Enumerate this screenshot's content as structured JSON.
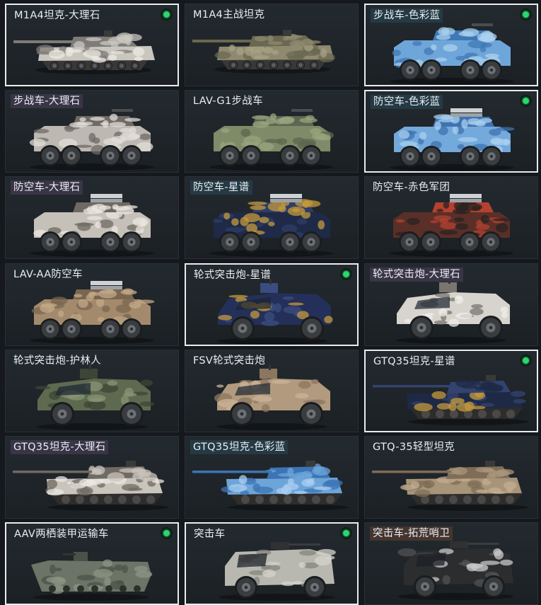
{
  "items": [
    {
      "label": "M1A4坦克-大理石",
      "badge": "none",
      "selected": true,
      "owned": true,
      "type": "tank",
      "palette": [
        "#c9c6c0",
        "#7f7b77",
        "#ece9e4"
      ]
    },
    {
      "label": "M1A4主战坦克",
      "badge": "none",
      "selected": false,
      "owned": false,
      "type": "tank",
      "palette": [
        "#8f8a6f",
        "#6a6850",
        "#a7a284"
      ]
    },
    {
      "label": "步战车-色彩蓝",
      "badge": "blue",
      "selected": true,
      "owned": true,
      "type": "ifv",
      "palette": [
        "#6fa6d9",
        "#3f78b6",
        "#a9d0ee"
      ]
    },
    {
      "label": "步战车-大理石",
      "badge": "purple",
      "selected": false,
      "owned": false,
      "type": "ifv",
      "palette": [
        "#bdb8b1",
        "#6f6a66",
        "#e2ded8"
      ]
    },
    {
      "label": "LAV-G1步战车",
      "badge": "none",
      "selected": false,
      "owned": false,
      "type": "ifv",
      "palette": [
        "#7f8b68",
        "#5c6650",
        "#9aa47f"
      ]
    },
    {
      "label": "防空车-色彩蓝",
      "badge": "blue",
      "selected": true,
      "owned": true,
      "type": "aa",
      "palette": [
        "#74a9dc",
        "#3e73b0",
        "#a8cfee"
      ]
    },
    {
      "label": "防空车-大理石",
      "badge": "purple",
      "selected": false,
      "owned": false,
      "type": "aa",
      "palette": [
        "#c5c0b8",
        "#6e6962",
        "#e9e5df"
      ]
    },
    {
      "label": "防空车-星谱",
      "badge": "blue",
      "selected": false,
      "owned": false,
      "type": "aa",
      "palette": [
        "#1f2a48",
        "#2f3d66",
        "#c49a3c"
      ]
    },
    {
      "label": "防空车-赤色军团",
      "badge": "none",
      "selected": false,
      "owned": false,
      "type": "aa",
      "palette": [
        "#5a2f28",
        "#b4412f",
        "#2a2322"
      ]
    },
    {
      "label": "LAV-AA防空车",
      "badge": "none",
      "selected": false,
      "owned": false,
      "type": "aa",
      "palette": [
        "#a48a6c",
        "#7a6550",
        "#c2a887"
      ]
    },
    {
      "label": "轮式突击炮-星谱",
      "badge": "none",
      "selected": true,
      "owned": true,
      "type": "apc",
      "palette": [
        "#24305a",
        "#3b4c80",
        "#c49a3c"
      ]
    },
    {
      "label": "轮式突击炮-大理石",
      "badge": "purple",
      "selected": false,
      "owned": false,
      "type": "apc",
      "palette": [
        "#d7d3cd",
        "#7a756f",
        "#f0ede9"
      ]
    },
    {
      "label": "轮式突击炮-护林人",
      "badge": "none",
      "selected": false,
      "owned": false,
      "type": "apc",
      "palette": [
        "#5d6a50",
        "#3d4636",
        "#8a9474"
      ]
    },
    {
      "label": "FSV轮式突击炮",
      "badge": "none",
      "selected": false,
      "owned": false,
      "type": "apc",
      "palette": [
        "#b29a7e",
        "#8c7660",
        "#cbb497"
      ]
    },
    {
      "label": "GTQ35坦克-星谱",
      "badge": "none",
      "selected": true,
      "owned": true,
      "type": "ltank",
      "palette": [
        "#1e2946",
        "#34436e",
        "#c49a3c"
      ]
    },
    {
      "label": "GTQ35坦克-大理石",
      "badge": "purple",
      "selected": false,
      "owned": false,
      "type": "ltank",
      "palette": [
        "#c9c4bc",
        "#6f6a63",
        "#ebe7e1"
      ]
    },
    {
      "label": "GTQ35坦克-色彩蓝",
      "badge": "blue",
      "selected": false,
      "owned": false,
      "type": "ltank",
      "palette": [
        "#6ea5d9",
        "#3c74b4",
        "#a9cff0"
      ]
    },
    {
      "label": "GTQ-35轻型坦克",
      "badge": "none",
      "selected": false,
      "owned": false,
      "type": "ltank",
      "palette": [
        "#a89479",
        "#7f6d57",
        "#c3ae91"
      ]
    },
    {
      "label": "AAV两栖装甲运输车",
      "badge": "none",
      "selected": true,
      "owned": true,
      "type": "aav",
      "palette": [
        "#6b7466",
        "#4b5249",
        "#8c9486"
      ]
    },
    {
      "label": "突击车",
      "badge": "none",
      "selected": true,
      "owned": true,
      "type": "truck",
      "palette": [
        "#b8b8b0",
        "#85857d",
        "#d4d4cc"
      ]
    },
    {
      "label": "突击车-拓荒哨卫",
      "badge": "brown",
      "selected": false,
      "owned": false,
      "type": "truck",
      "palette": [
        "#2c2d2e",
        "#505254",
        "#c8c8c8"
      ]
    }
  ]
}
